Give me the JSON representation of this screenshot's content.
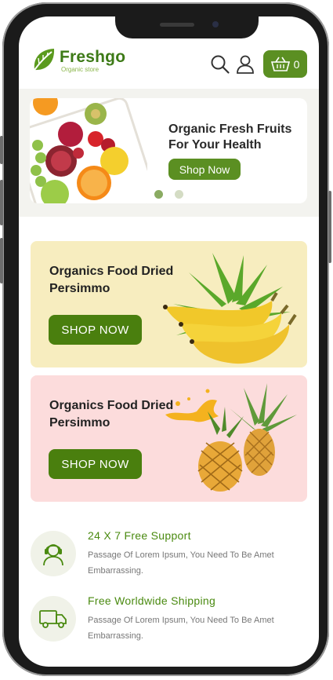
{
  "brand": {
    "name": "Freshgo",
    "tagline": "Organic store"
  },
  "cart": {
    "count": "0"
  },
  "hero": {
    "title": "Organic Fresh Fruits For Your Health",
    "button": "Shop Now",
    "active_slide": 1,
    "slides": 2
  },
  "promos": [
    {
      "title": "Organics Food Dried Persimmo",
      "button": "SHOP NOW",
      "bg": "#f7edbf"
    },
    {
      "title": "Organics Food Dried Persimmo",
      "button": "SHOP NOW",
      "bg": "#fcdcdc"
    }
  ],
  "features": [
    {
      "title": "24 X 7 Free Support",
      "desc": "Passage Of Lorem Ipsum, You Need To Be Amet Embarrassing.",
      "icon": "support-agent-icon"
    },
    {
      "title": "Free Worldwide Shipping",
      "desc": "Passage Of Lorem Ipsum, You Need To Be Amet Embarrassing.",
      "icon": "truck-icon"
    }
  ],
  "colors": {
    "accent": "#5b8f22",
    "button_dark": "#4a7f0e",
    "feature_title": "#4a8a10"
  }
}
